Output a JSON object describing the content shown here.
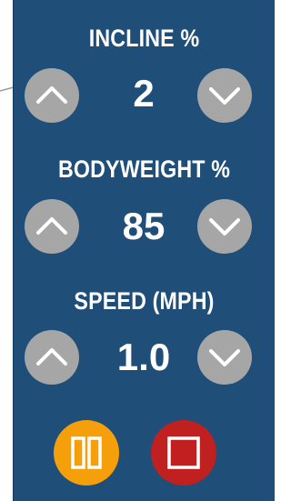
{
  "controls": [
    {
      "label": "INCLINE %",
      "value": "2",
      "up_icon": "chevron-up-icon",
      "down_icon": "chevron-down-icon"
    },
    {
      "label": "BODYWEIGHT %",
      "value": "85",
      "up_icon": "chevron-up-icon",
      "down_icon": "chevron-down-icon"
    },
    {
      "label": "SPEED (MPH)",
      "value": "1.0",
      "up_icon": "chevron-up-icon",
      "down_icon": "chevron-down-icon"
    }
  ],
  "actions": {
    "pause": {
      "icon": "pause-icon",
      "color": "#f59f0b"
    },
    "stop": {
      "icon": "stop-icon",
      "color": "#c0201f"
    }
  },
  "colors": {
    "panel": "#1f4e79",
    "button": "#a6a6a6",
    "text": "#ffffff"
  }
}
